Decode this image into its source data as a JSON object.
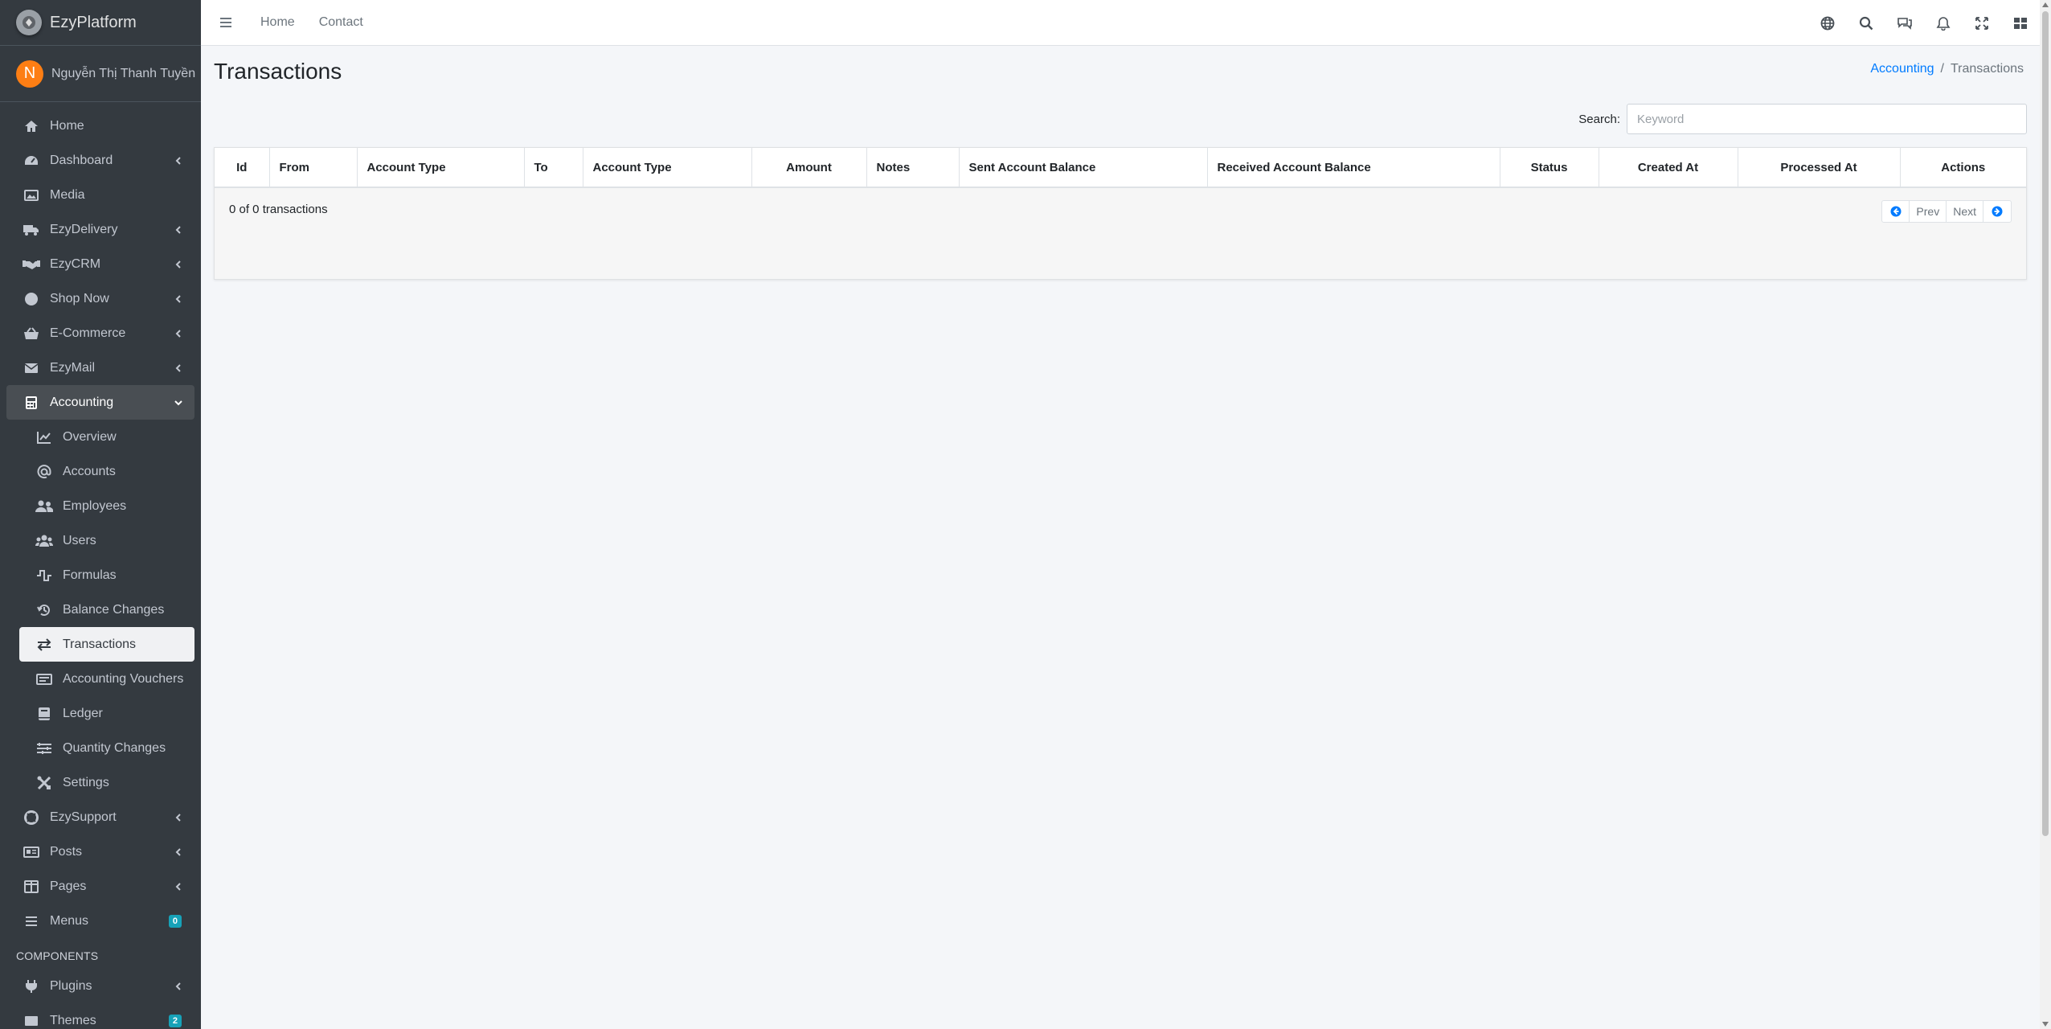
{
  "brand": {
    "name": "EzyPlatform"
  },
  "user": {
    "initial": "N",
    "name": "Nguyễn Thị Thanh Tuyền"
  },
  "sidebar": {
    "items": [
      {
        "label": "Home",
        "icon": "home-icon"
      },
      {
        "label": "Dashboard",
        "icon": "dashboard-icon"
      },
      {
        "label": "Media",
        "icon": "image-icon"
      },
      {
        "label": "EzyDelivery",
        "icon": "truck-icon"
      },
      {
        "label": "EzyCRM",
        "icon": "handshake-icon"
      },
      {
        "label": "Shop Now",
        "icon": "circle-icon"
      },
      {
        "label": "E-Commerce",
        "icon": "basket-icon"
      },
      {
        "label": "EzyMail",
        "icon": "envelope-icon"
      },
      {
        "label": "Accounting",
        "icon": "calculator-icon"
      }
    ],
    "accounting_sub": [
      {
        "label": "Overview",
        "icon": "chart-line-icon"
      },
      {
        "label": "Accounts",
        "icon": "at-icon"
      },
      {
        "label": "Employees",
        "icon": "user-friends-icon"
      },
      {
        "label": "Users",
        "icon": "users-icon"
      },
      {
        "label": "Formulas",
        "icon": "wave-square-icon"
      },
      {
        "label": "Balance Changes",
        "icon": "history-icon"
      },
      {
        "label": "Transactions",
        "icon": "exchange-icon"
      },
      {
        "label": "Accounting Vouchers",
        "icon": "voucher-icon"
      },
      {
        "label": "Ledger",
        "icon": "book-icon"
      },
      {
        "label": "Quantity Changes",
        "icon": "stack-icon"
      },
      {
        "label": "Settings",
        "icon": "tools-icon"
      }
    ],
    "items_after": [
      {
        "label": "EzySupport",
        "icon": "lifebuoy-icon"
      },
      {
        "label": "Posts",
        "icon": "newspaper-icon"
      },
      {
        "label": "Pages",
        "icon": "columns-icon"
      },
      {
        "label": "Menus",
        "icon": "bars-icon",
        "badge": "0"
      }
    ],
    "components_header": "COMPONENTS",
    "components": [
      {
        "label": "Plugins",
        "icon": "plug-icon"
      },
      {
        "label": "Themes",
        "icon": "themes-icon",
        "badge": "2"
      }
    ]
  },
  "topbar": {
    "links": [
      "Home",
      "Contact"
    ],
    "icons": [
      "globe-icon",
      "search-icon",
      "comments-icon",
      "bell-icon",
      "expand-icon",
      "grid-icon"
    ]
  },
  "page": {
    "title": "Transactions",
    "breadcrumb": {
      "parent": "Accounting",
      "separator": "/",
      "current": "Transactions"
    }
  },
  "search": {
    "label": "Search:",
    "placeholder": "Keyword",
    "value": ""
  },
  "table": {
    "columns": [
      "Id",
      "From",
      "Account Type",
      "To",
      "Account Type",
      "Amount",
      "Notes",
      "Sent Account Balance",
      "Received Account Balance",
      "Status",
      "Created At",
      "Processed At",
      "Actions"
    ],
    "count_text": "0 of 0 transactions",
    "pager": {
      "prev": "Prev",
      "next": "Next"
    }
  },
  "colors": {
    "sidebar_bg": "#343a40",
    "accent": "#007bff",
    "avatar": "#fd7e14",
    "badge": "#17a2b8"
  }
}
